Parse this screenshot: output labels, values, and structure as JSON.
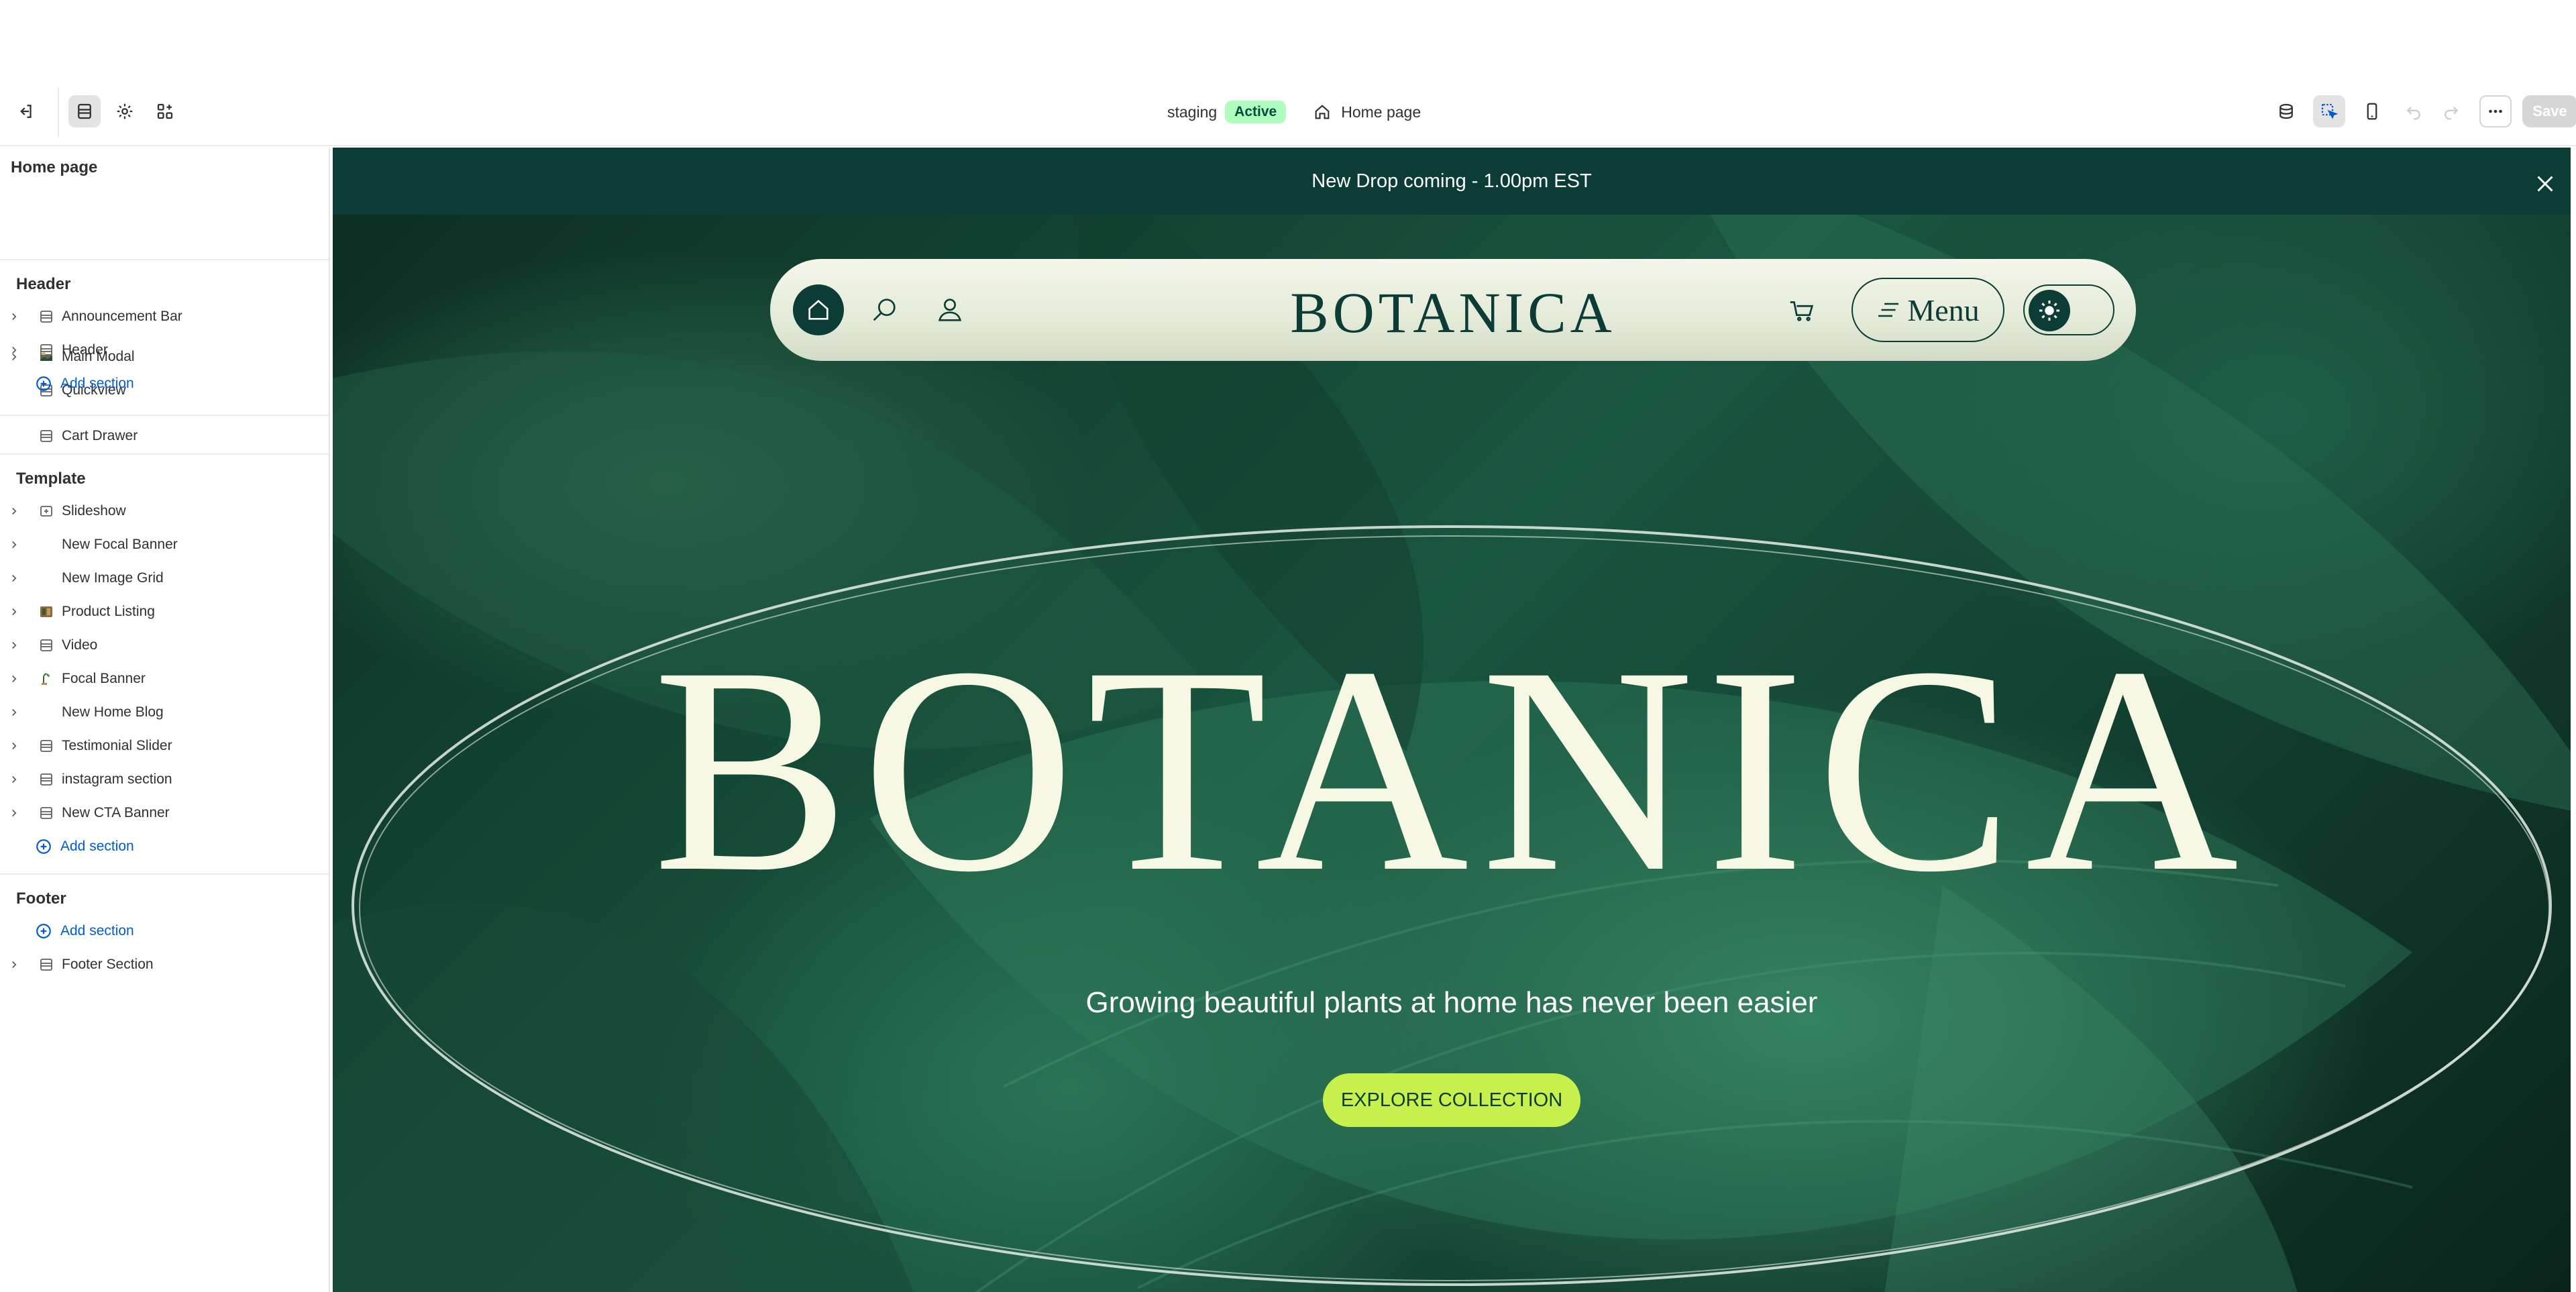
{
  "topbar": {
    "store_label": "staging",
    "status_badge": "Active",
    "page_name": "Home page",
    "save_label": "Save"
  },
  "sidebar": {
    "title": "Home page",
    "top_items": [
      {
        "label": "Main Modal",
        "icon": "image-block-icon"
      },
      {
        "label": "Quickview",
        "icon": "section-icon"
      }
    ],
    "groups": {
      "header": "Header",
      "template": "Template",
      "footer": "Footer"
    },
    "header_items": [
      {
        "label": "Announcement Bar",
        "icon": "section-icon"
      },
      {
        "label": "Header",
        "icon": "section-icon"
      }
    ],
    "cart_item": {
      "label": "Cart Drawer",
      "icon": "section-icon"
    },
    "template_items": [
      {
        "label": "Slideshow",
        "icon": "slideshow-icon"
      },
      {
        "label": "New Focal Banner",
        "icon": ""
      },
      {
        "label": "New Image Grid",
        "icon": ""
      },
      {
        "label": "Product Listing",
        "icon": "image-thumbnail-icon"
      },
      {
        "label": "Video",
        "icon": "section-icon"
      },
      {
        "label": "Focal Banner",
        "icon": "image-thumbnail-icon"
      },
      {
        "label": "New Home Blog",
        "icon": ""
      },
      {
        "label": "Testimonial Slider",
        "icon": "section-icon"
      },
      {
        "label": "instagram section",
        "icon": "section-icon"
      },
      {
        "label": "New CTA Banner",
        "icon": "section-icon"
      }
    ],
    "footer_items": [
      {
        "label": "Footer Section",
        "icon": "section-icon"
      }
    ],
    "add_section_label": "Add section"
  },
  "preview": {
    "announcement": "New Drop coming - 1.00pm EST",
    "logo": "BOTANICA",
    "menu_label": "Menu",
    "hero_title": "BOTANICA",
    "hero_subtitle": "Growing beautiful plants at home has never been easier",
    "cta_label": "EXPLORE COLLECTION"
  },
  "colors": {
    "brand_dark": "#0b3d36",
    "cta": "#c8f04d",
    "badge_bg": "#affebf",
    "link_blue": "#005bd3"
  }
}
